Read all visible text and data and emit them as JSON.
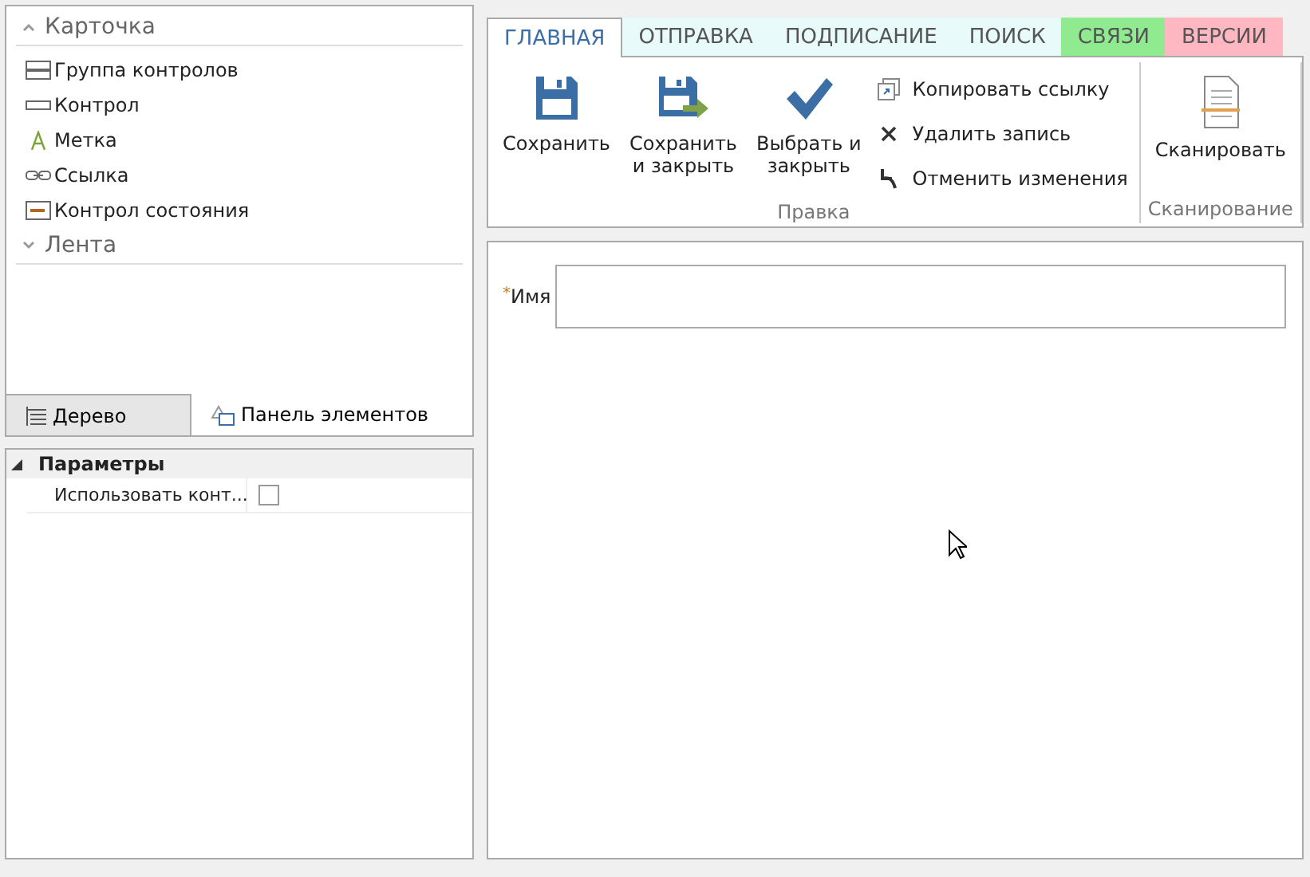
{
  "toolbox": {
    "groups": [
      {
        "label": "Карточка",
        "expanded": true,
        "items": [
          {
            "label": "Группа контролов",
            "kind": "group"
          },
          {
            "label": "Контрол",
            "kind": "control"
          },
          {
            "label": "Метка",
            "kind": "label"
          },
          {
            "label": "Ссылка",
            "kind": "link"
          },
          {
            "label": "Контрол состояния",
            "kind": "state"
          }
        ]
      },
      {
        "label": "Лента",
        "expanded": false
      }
    ]
  },
  "bottom_tabs": [
    {
      "label": "Дерево",
      "kind": "tree",
      "selected": false
    },
    {
      "label": "Панель элементов",
      "kind": "palette",
      "selected": true
    }
  ],
  "properties": {
    "category": {
      "label": "Параметры",
      "expanded": true
    },
    "rows": [
      {
        "name": "Использовать конт...",
        "checked": false
      }
    ]
  },
  "ribbon": {
    "tabs": [
      {
        "label": "ГЛАВНАЯ",
        "selected": true,
        "color": "#ffffff"
      },
      {
        "label": "ОТПРАВКА",
        "selected": false,
        "color": "#e8fafa"
      },
      {
        "label": "ПОДПИСАНИЕ",
        "selected": false,
        "color": "#e8fafa"
      },
      {
        "label": "ПОИСК",
        "selected": false,
        "color": "#e8fafa"
      },
      {
        "label": "СВЯЗИ",
        "selected": false,
        "color": "#90ea90"
      },
      {
        "label": "ВЕРСИИ",
        "selected": false,
        "color": "#ffb8c2"
      }
    ],
    "groups": [
      {
        "label": "Правка",
        "large_buttons": [
          {
            "label": "Сохранить",
            "kind": "save"
          },
          {
            "label": "Сохранить\nи закрыть",
            "kind": "save-close"
          },
          {
            "label": "Выбрать и\nзакрыть",
            "kind": "select"
          }
        ],
        "small_buttons": [
          {
            "label": "Копировать ссылку",
            "kind": "copy"
          },
          {
            "label": "Удалить запись",
            "kind": "delete"
          },
          {
            "label": "Отменить изменения",
            "kind": "undo"
          }
        ]
      },
      {
        "label": "Сканирование",
        "large_buttons": [
          {
            "label": "Сканировать",
            "kind": "scan"
          }
        ]
      }
    ]
  },
  "form": {
    "fields": [
      {
        "label": "Имя",
        "required_mark": "*"
      }
    ]
  }
}
